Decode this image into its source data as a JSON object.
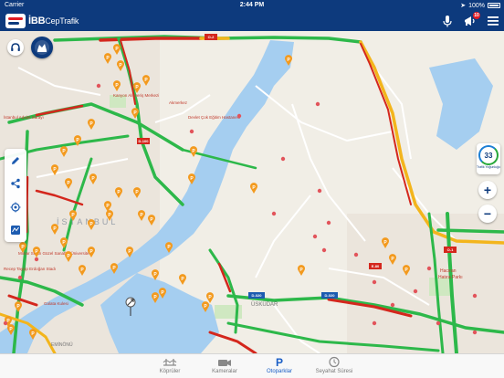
{
  "status_bar": {
    "carrier": "Carrier",
    "time": "2:44 PM",
    "battery": "100%"
  },
  "app": {
    "name_bold": "İBB",
    "name_light": "CepTrafik"
  },
  "header_icons": {
    "notification_count": "10"
  },
  "map": {
    "labels": {
      "istanbul": "İSTANBUL",
      "haciran": "Hacıran",
      "hatira": "Hatıra Parkı",
      "uskudar": "ÜSKÜDAR",
      "adalet": "İstanbul Adalet Sarayı",
      "mimar": "Mimar Sinan Güzel Sanatlar Üniversitesi",
      "recep": "Recep Tayyip Erdoğan Stadı",
      "eminonu": "EMİNÖNÜ",
      "akmerkez": "Akmerkez",
      "kanyon": "Kanyon Alışveriş Merkezi",
      "galata": "Galata Kulesi",
      "devlet": "Devlet Çok Eğitim Hastanesi"
    },
    "road_shields": [
      "O-2",
      "D-100",
      "E-80",
      "D-020",
      "O-1"
    ],
    "colors": {
      "traffic_free": "#2db84a",
      "traffic_slow": "#f3b51c",
      "traffic_jam": "#d4271d",
      "water": "#a5cef0",
      "land": "#f1eee6"
    }
  },
  "gauge": {
    "value": "33",
    "caption": "Trafik Yoğunluğu"
  },
  "tabs": [
    {
      "label": "Köprüler",
      "icon": "bridge-icon"
    },
    {
      "label": "Kameralar",
      "icon": "camera-icon"
    },
    {
      "label": "Otoparklar",
      "icon": "parking-icon"
    },
    {
      "label": "Seyahat Süresi",
      "icon": "travel-time-icon"
    }
  ]
}
